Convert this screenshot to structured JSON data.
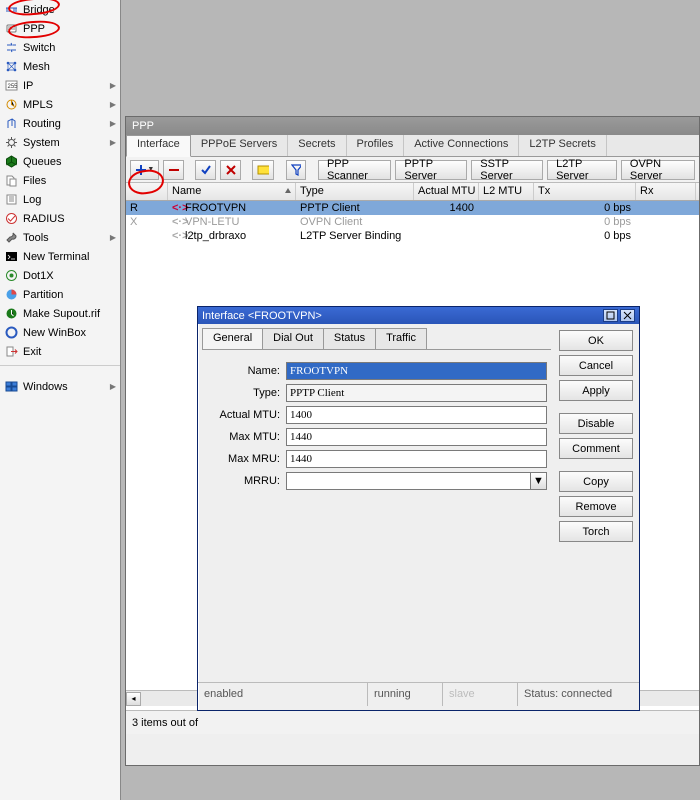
{
  "sidebar": {
    "items": [
      {
        "label": "Bridge",
        "icon": "bridge",
        "sub": false
      },
      {
        "label": "PPP",
        "icon": "ppp",
        "sub": false,
        "highlight": true
      },
      {
        "label": "Switch",
        "icon": "switch",
        "sub": false
      },
      {
        "label": "Mesh",
        "icon": "mesh",
        "sub": false
      },
      {
        "label": "IP",
        "icon": "ip",
        "sub": true
      },
      {
        "label": "MPLS",
        "icon": "mpls",
        "sub": true
      },
      {
        "label": "Routing",
        "icon": "routing",
        "sub": true
      },
      {
        "label": "System",
        "icon": "system",
        "sub": true
      },
      {
        "label": "Queues",
        "icon": "queues",
        "sub": false
      },
      {
        "label": "Files",
        "icon": "files",
        "sub": false
      },
      {
        "label": "Log",
        "icon": "log",
        "sub": false
      },
      {
        "label": "RADIUS",
        "icon": "radius",
        "sub": false
      },
      {
        "label": "Tools",
        "icon": "tools",
        "sub": true
      },
      {
        "label": "New Terminal",
        "icon": "terminal",
        "sub": false
      },
      {
        "label": "Dot1X",
        "icon": "dot1x",
        "sub": false
      },
      {
        "label": "Partition",
        "icon": "partition",
        "sub": false
      },
      {
        "label": "Make Supout.rif",
        "icon": "supout",
        "sub": false
      },
      {
        "label": "New WinBox",
        "icon": "winbox",
        "sub": false
      },
      {
        "label": "Exit",
        "icon": "exit",
        "sub": false
      }
    ],
    "windows_label": "Windows"
  },
  "ppp": {
    "title": "PPP",
    "tabs": [
      "Interface",
      "PPPoE Servers",
      "Secrets",
      "Profiles",
      "Active Connections",
      "L2TP Secrets"
    ],
    "active_tab": 0,
    "toolbar_buttons": [
      "PPP Scanner",
      "PPTP Server",
      "SSTP Server",
      "L2TP Server",
      "OVPN Server"
    ],
    "columns": [
      "",
      "Name",
      "Type",
      "Actual MTU",
      "L2 MTU",
      "Tx",
      "Rx"
    ],
    "rows": [
      {
        "flag": "R",
        "name": "FROOTVPN",
        "type": "PPTP Client",
        "amtu": "1400",
        "l2": "",
        "tx": "0 bps",
        "rx": "",
        "sel": true,
        "link": "red"
      },
      {
        "flag": "X",
        "name": "VPN-LETU",
        "type": "OVPN Client",
        "amtu": "",
        "l2": "",
        "tx": "0 bps",
        "rx": "",
        "disabled": true,
        "link": "grey"
      },
      {
        "flag": "",
        "name": "l2tp_drbraxo",
        "type": "L2TP Server Binding",
        "amtu": "",
        "l2": "",
        "tx": "0 bps",
        "rx": "",
        "link": "grey"
      }
    ],
    "footer": "3 items out of"
  },
  "dialog": {
    "title": "Interface <FROOTVPN>",
    "tabs": [
      "General",
      "Dial Out",
      "Status",
      "Traffic"
    ],
    "active_tab": 0,
    "fields": {
      "name_label": "Name:",
      "name_value": "FROOTVPN",
      "type_label": "Type:",
      "type_value": "PPTP Client",
      "amtu_label": "Actual MTU:",
      "amtu_value": "1400",
      "maxmtu_label": "Max MTU:",
      "maxmtu_value": "1440",
      "maxmru_label": "Max MRU:",
      "maxmru_value": "1440",
      "mrru_label": "MRRU:",
      "mrru_value": ""
    },
    "buttons": [
      "OK",
      "Cancel",
      "Apply",
      "Disable",
      "Comment",
      "Copy",
      "Remove",
      "Torch"
    ],
    "status": {
      "enabled": "enabled",
      "running": "running",
      "slave": "slave",
      "conn": "Status: connected"
    }
  }
}
